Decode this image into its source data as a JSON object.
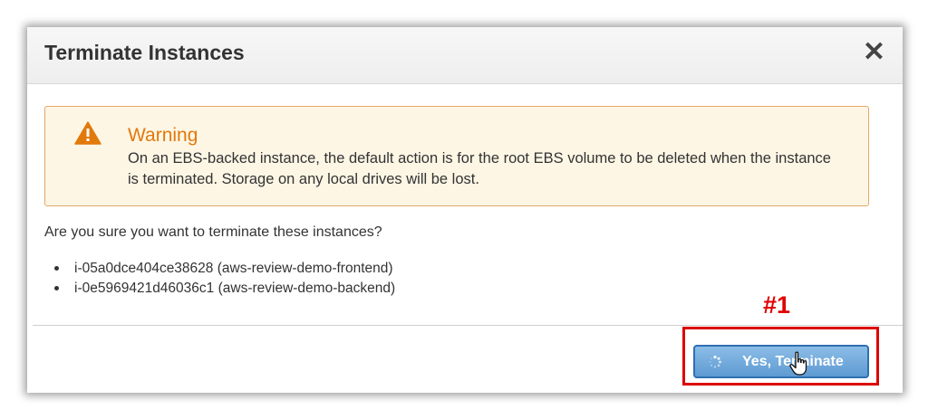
{
  "dialog": {
    "title": "Terminate Instances",
    "close_glyph": "✕"
  },
  "warning": {
    "icon": "warning-triangle-icon",
    "title": "Warning",
    "message": "On an EBS-backed instance, the default action is for the root EBS volume to be deleted when the instance is terminated. Storage on any local drives will be lost.",
    "color": "#e2790b"
  },
  "confirmation": {
    "question": "Are you sure you want to terminate these instances?",
    "instances": [
      "i-05a0dce404ce38628 (aws-review-demo-frontend)",
      "i-0e5969421d46036c1 (aws-review-demo-backend)"
    ]
  },
  "annotation": {
    "label": "#1",
    "color": "#e00000"
  },
  "actions": {
    "confirm_label": "Yes, Terminate",
    "confirm_icon": "spinner-icon",
    "pointer": "hand-cursor-icon"
  }
}
